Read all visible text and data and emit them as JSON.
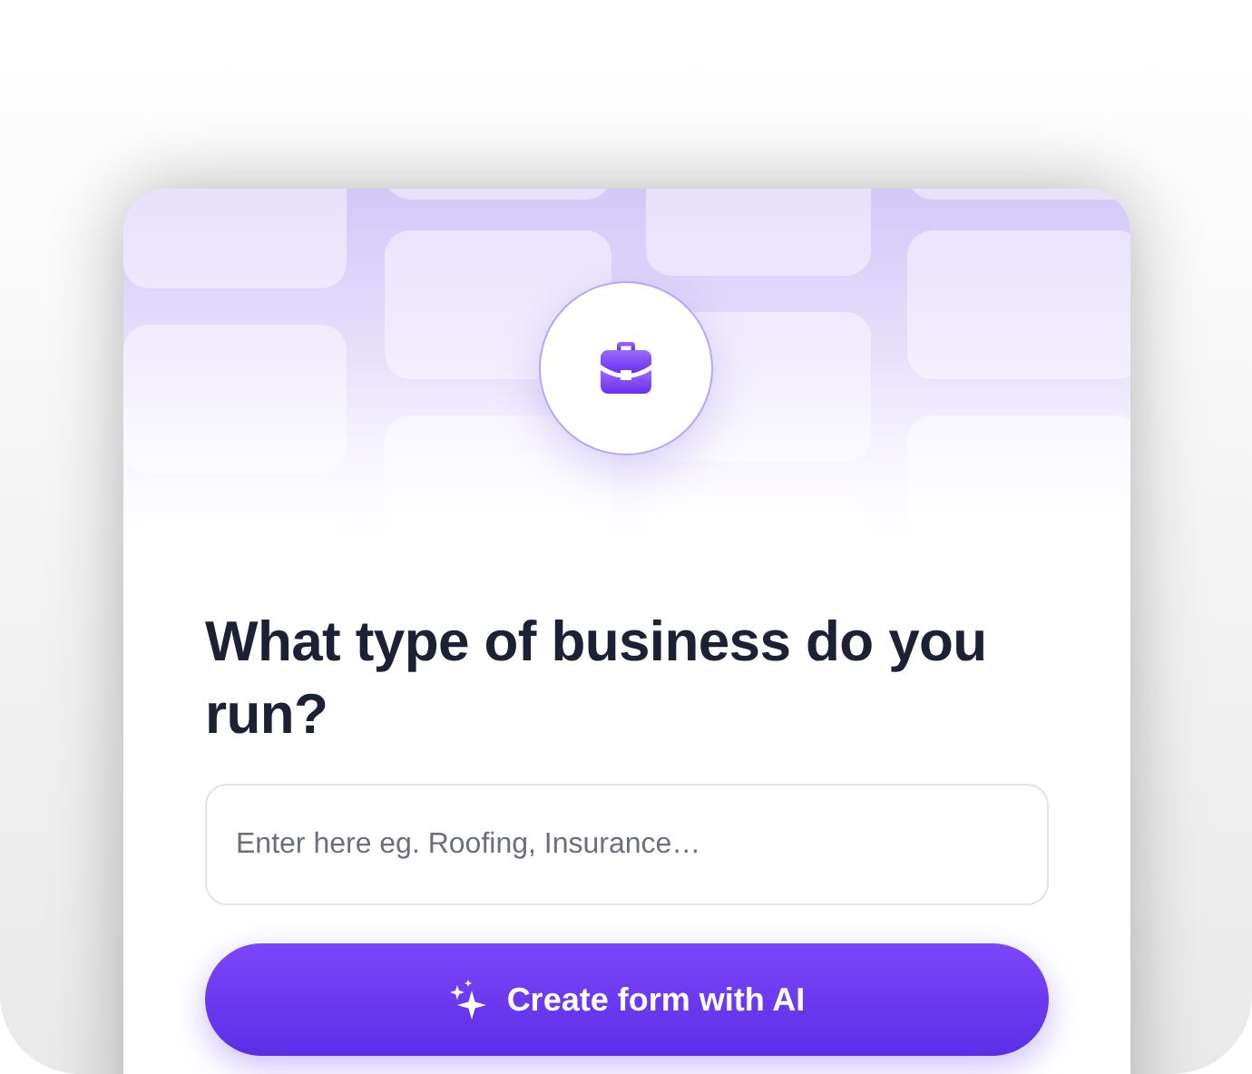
{
  "question": {
    "title": "What type of business do you run?"
  },
  "field": {
    "placeholder": "Enter here eg. Roofing, Insurance…"
  },
  "button": {
    "label": "Create form with AI"
  }
}
